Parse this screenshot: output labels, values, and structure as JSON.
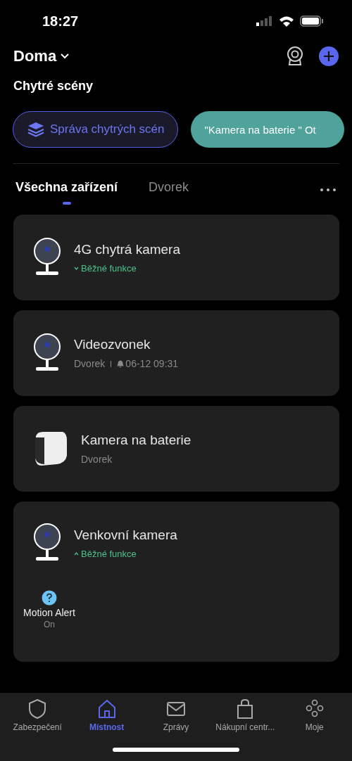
{
  "status_bar": {
    "time": "18:27"
  },
  "header": {
    "home": "Doma"
  },
  "scenes": {
    "title": "Chytré scény",
    "chips": [
      {
        "kind": "manage",
        "label": "Správa chytrých scén"
      },
      {
        "kind": "scene",
        "label": "\"Kamera na baterie \" Ot"
      }
    ]
  },
  "tabs": [
    {
      "label": "Všechna zařízení",
      "selected": true
    },
    {
      "label": "Dvorek",
      "selected": false
    }
  ],
  "devices": [
    {
      "kind": "indoor",
      "name": "4G chytrá kamera",
      "functions": {
        "label": "Běžné funkce",
        "expanded": false
      }
    },
    {
      "kind": "indoor",
      "name": "Videozvonek",
      "room": "Dvorek",
      "alert": "06-12 09:31"
    },
    {
      "kind": "battery",
      "name": "Kamera na baterie",
      "room": "Dvorek"
    },
    {
      "kind": "indoor",
      "name": "Venkovní kamera",
      "functions": {
        "label": "Běžné funkce",
        "expanded": true
      },
      "shortcuts": [
        {
          "label": "Motion Alert",
          "value": "On"
        }
      ]
    }
  ],
  "nav": [
    {
      "kind": "shield",
      "label": "Zabezpečení",
      "selected": false
    },
    {
      "kind": "home",
      "label": "Místnost",
      "selected": true
    },
    {
      "kind": "mail",
      "label": "Zprávy",
      "selected": false
    },
    {
      "kind": "bag",
      "label": "Nákupní centr...",
      "selected": false
    },
    {
      "kind": "dots",
      "label": "Moje",
      "selected": false
    }
  ]
}
